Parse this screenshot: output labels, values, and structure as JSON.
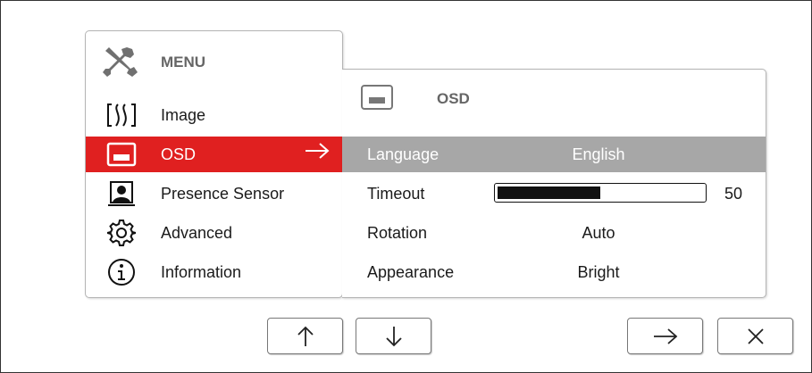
{
  "menu": {
    "title": "MENU",
    "icon": "tools-icon",
    "items": [
      {
        "label": "Image",
        "icon": "image-adjust-icon"
      },
      {
        "label": "OSD",
        "icon": "osd-icon",
        "selected": true
      },
      {
        "label": "Presence Sensor",
        "icon": "person-icon"
      },
      {
        "label": "Advanced",
        "icon": "gear-icon"
      },
      {
        "label": "Information",
        "icon": "info-icon"
      }
    ]
  },
  "submenu": {
    "title": "OSD",
    "icon": "osd-icon",
    "rows": {
      "language": {
        "label": "Language",
        "value": "English"
      },
      "timeout": {
        "label": "Timeout",
        "value": "50",
        "fraction": 0.5
      },
      "rotation": {
        "label": "Rotation",
        "value": "Auto"
      },
      "appearance": {
        "label": "Appearance",
        "value": "Bright"
      }
    }
  },
  "buttons": [
    {
      "name": "up",
      "icon": "arrow-up-icon"
    },
    {
      "name": "down",
      "icon": "arrow-down-icon"
    },
    {
      "name": "enter",
      "icon": "arrow-right-icon"
    },
    {
      "name": "close",
      "icon": "close-icon"
    }
  ],
  "colors": {
    "selected_menu": "#e02020",
    "selected_row": "#a7a7a7",
    "border": "#b4b4b4"
  }
}
